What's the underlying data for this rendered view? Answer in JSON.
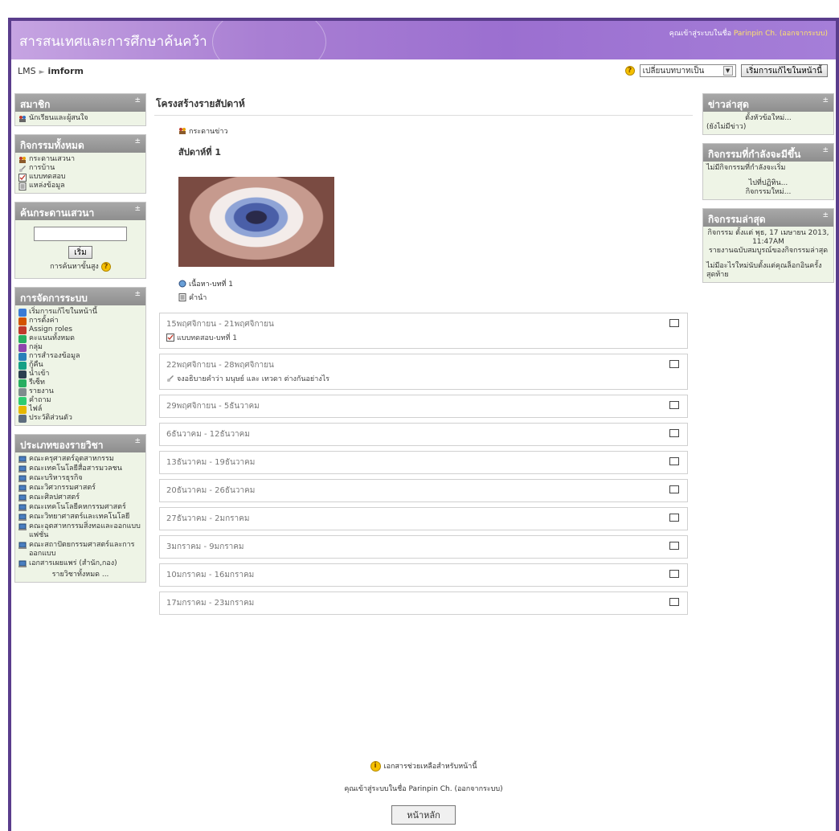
{
  "header": {
    "site_title": "สารสนเทศและการศึกษาค้นคว้า",
    "login_prefix": "คุณเข้าสู่ระบบในชื่อ",
    "user": "Parinpin Ch.",
    "logout": "(ออกจากระบบ)"
  },
  "nav": {
    "crumb_1": "LMS",
    "crumb_2": "imform",
    "role_select": "เปลี่ยนบทบาทเป็น",
    "edit_button": "เริ่มการแก้ไขในหน้านี้"
  },
  "left": {
    "members": {
      "title": "สมาชิก",
      "items": [
        "นักเรียนและผู้สนใจ"
      ]
    },
    "activities": {
      "title": "กิจกรรมทั้งหมด",
      "items": [
        "กระดานเสวนา",
        "การบ้าน",
        "แบบทดสอบ",
        "แหล่งข้อมูล"
      ]
    },
    "search": {
      "title": "ค้นกระดานเสวนา",
      "button": "เริ่ม",
      "advanced": "การค้นหาขั้นสูง"
    },
    "admin": {
      "title": "การจัดการระบบ",
      "items": [
        "เริ่มการแก้ไขในหน้านี้",
        "การตั้งค่า",
        "Assign roles",
        "คะแนนทั้งหมด",
        "กลุ่ม",
        "การสำรองข้อมูล",
        "กู้คืน",
        "นำเข้า",
        "รีเซ็ท",
        "รายงาน",
        "คำถาม",
        "ไฟล์",
        "ประวัติส่วนตัว"
      ]
    },
    "categories": {
      "title": "ประเภทของรายวิชา",
      "items": [
        "คณะครุศาสตร์อุตสาหกรรม",
        "คณะเทคโนโลยีสื่อสารมวลชน",
        "คณะบริหารธุรกิจ",
        "คณะวิศวกรรมศาสตร์",
        "คณะศิลปศาสตร์",
        "คณะเทคโนโลยีคหกรรมศาสตร์",
        "คณะวิทยาศาสตร์และเทคโนโลยี",
        "คณะอุตสาหกรรมสิ่งทอและออกแบบแฟชั่น",
        "คณะสถาปัตยกรรมศาสตร์และการออกแบบ",
        "เอกสารเผยแพร่ (สำนัก,กอง)"
      ],
      "all": "รายวิชาทั้งหมด ..."
    }
  },
  "main": {
    "title": "โครงสร้างรายสัปดาห์",
    "news": "กระดานข่าว",
    "week_title": "สัปดาห์ที่ 1",
    "resource_1": "เนื้อหา-บทที่ 1",
    "resource_2": "คำนำ",
    "weeks": [
      {
        "dates": "15พฤศจิกายน - 21พฤศจิกายน",
        "activity": "แบบทดสอบ-บทที่ 1"
      },
      {
        "dates": "22พฤศจิกายน - 28พฤศจิกายน",
        "activity": "จงอธิบายคำว่า มนุษย์ และ เทวดา ต่างกันอย่างไร"
      },
      {
        "dates": "29พฤศจิกายน - 5ธันวาคม",
        "activity": ""
      },
      {
        "dates": "6ธันวาคม - 12ธันวาคม",
        "activity": ""
      },
      {
        "dates": "13ธันวาคม - 19ธันวาคม",
        "activity": ""
      },
      {
        "dates": "20ธันวาคม - 26ธันวาคม",
        "activity": ""
      },
      {
        "dates": "27ธันวาคม - 2มกราคม",
        "activity": ""
      },
      {
        "dates": "3มกราคม - 9มกราคม",
        "activity": ""
      },
      {
        "dates": "10มกราคม - 16มกราคม",
        "activity": ""
      },
      {
        "dates": "17มกราคม - 23มกราคม",
        "activity": ""
      }
    ]
  },
  "right": {
    "news": {
      "title": "ข่าวล่าสุด",
      "add": "ตั้งหัวข้อใหม่...",
      "none": "(ยังไม่มีข่าว)"
    },
    "upcoming": {
      "title": "กิจกรรมที่กำลังจะมีขึ้น",
      "none": "ไม่มีกิจกรรมที่กำลังจะเริ่ม",
      "go": "ไปที่ปฏิทิน...",
      "new": "กิจกรรมใหม่..."
    },
    "recent": {
      "title": "กิจกรรมล่าสุด",
      "since": "กิจกรรม ตั้งแต่ พุธ, 17 เมษายน 2013, 11:47AM",
      "full": "รายงานฉบับสมบูรณ์ของกิจกรรมล่าสุด",
      "nothing": "ไม่มีอะไรใหม่นับตั้งแต่คุณล็อกอินครั้งสุดท้าย"
    }
  },
  "footer": {
    "help": "เอกสารช่วยเหลือสำหรับหน้านี้",
    "logged": "คุณเข้าสู่ระบบในชื่อ Parinpin Ch. (ออกจากระบบ)",
    "home": "หน้าหลัก"
  }
}
